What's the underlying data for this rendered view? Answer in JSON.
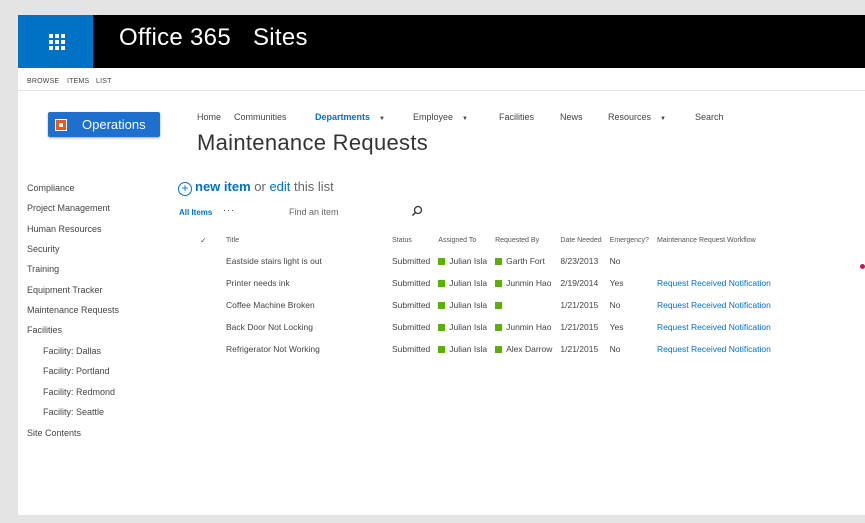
{
  "suite": {
    "app_name": "Office 365",
    "section": "Sites"
  },
  "ribbon": {
    "tabs": [
      "BROWSE",
      "ITEMS",
      "LIST"
    ]
  },
  "site": {
    "name": "Operations"
  },
  "top_nav": {
    "items": [
      {
        "label": "Home",
        "dropdown": false,
        "selected": false
      },
      {
        "label": "Communities",
        "dropdown": false,
        "selected": false
      },
      {
        "label": "Departments",
        "dropdown": true,
        "selected": true
      },
      {
        "label": "Employee",
        "dropdown": true,
        "selected": false
      },
      {
        "label": "Facilities",
        "dropdown": false,
        "selected": false
      },
      {
        "label": "News",
        "dropdown": false,
        "selected": false
      },
      {
        "label": "Resources",
        "dropdown": true,
        "selected": false
      },
      {
        "label": "Search",
        "dropdown": false,
        "selected": false
      }
    ],
    "caret": "▼"
  },
  "page": {
    "title": "Maintenance Requests"
  },
  "quick_launch": {
    "items": [
      {
        "label": "Compliance",
        "indent": false
      },
      {
        "label": "Project Management",
        "indent": false
      },
      {
        "label": "Human Resources",
        "indent": false
      },
      {
        "label": "Security",
        "indent": false
      },
      {
        "label": "Training",
        "indent": false
      },
      {
        "label": "Equipment Tracker",
        "indent": false
      },
      {
        "label": "Maintenance Requests",
        "indent": false
      },
      {
        "label": "Facilities",
        "indent": false
      },
      {
        "label": "Facility: Dallas",
        "indent": true
      },
      {
        "label": "Facility: Portland",
        "indent": true
      },
      {
        "label": "Facility: Redmond",
        "indent": true
      },
      {
        "label": "Facility: Seattle",
        "indent": true
      },
      {
        "label": "Site Contents",
        "indent": false
      }
    ]
  },
  "list": {
    "new_item": "new item",
    "or_text": "or",
    "edit_text": "edit",
    "this_list": "this list",
    "view_name": "All Items",
    "more": "···",
    "search_placeholder": "Find an item",
    "columns": [
      "✓",
      "Title",
      "Status",
      "Assigned To",
      "Requested By",
      "Date Needed",
      "Emergency?",
      "Maintenance Request Workflow"
    ],
    "rows": [
      {
        "title": "Eastside stairs light is out",
        "status": "Submitted",
        "assigned": "Julian Isla",
        "requested": "Garth Fort",
        "date": "8/23/2013",
        "emergency": "No",
        "workflow": ""
      },
      {
        "title": "Printer needs ink",
        "status": "Submitted",
        "assigned": "Julian Isla",
        "requested": "Junmin Hao",
        "date": "2/19/2014",
        "emergency": "Yes",
        "workflow": "Request Received Notification"
      },
      {
        "title": "Coffee Machine Broken",
        "status": "Submitted",
        "assigned": "Julian Isla",
        "requested": "",
        "date": "1/21/2015",
        "emergency": "No",
        "workflow": "Request Received Notification"
      },
      {
        "title": "Back Door Not Locking",
        "status": "Submitted",
        "assigned": "Julian Isla",
        "requested": "Junmin Hao",
        "date": "1/21/2015",
        "emergency": "Yes",
        "workflow": "Request Received Notification"
      },
      {
        "title": "Refrigerator Not Working",
        "status": "Submitted",
        "assigned": "Julian Isla",
        "requested": "Alex Darrow",
        "date": "1/21/2015",
        "emergency": "No",
        "workflow": "Request Received Notification"
      }
    ]
  },
  "colors": {
    "accent": "#0072c6",
    "presence": "#59b200",
    "suite_bar": "#000000",
    "site_tile": "#1f6fcf",
    "site_icon": "#ea5a1c"
  }
}
